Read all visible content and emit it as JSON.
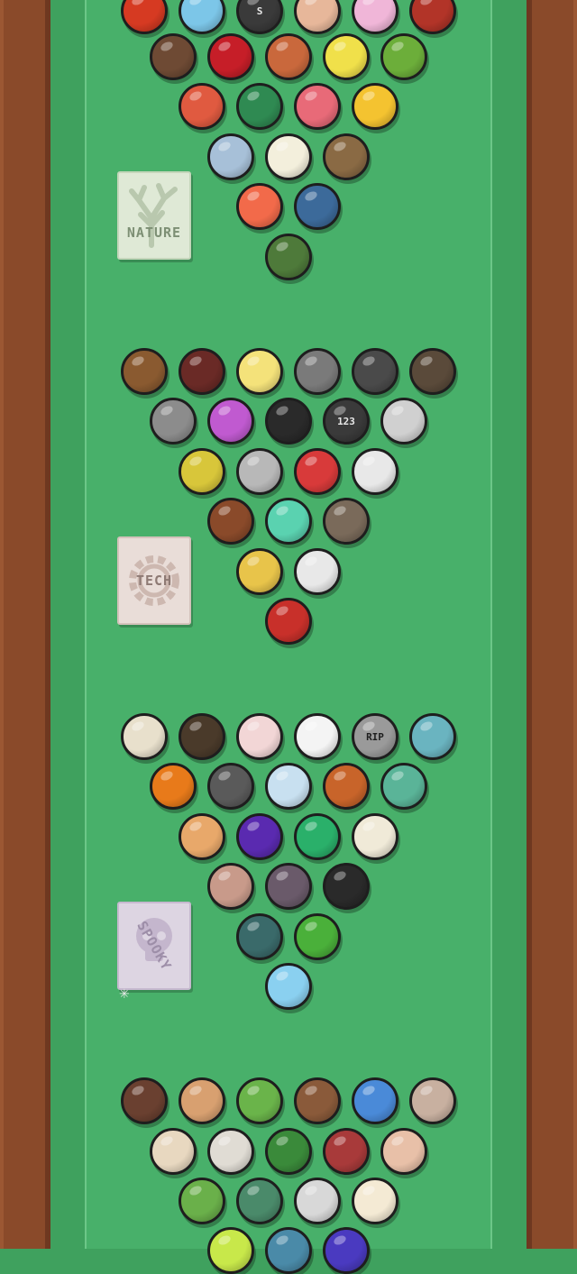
{
  "table": {
    "rail_color": "#8a4a2a",
    "felt_color": "#48b06a"
  },
  "packs": [
    {
      "id": "nature",
      "label": "NATURE",
      "icon": "tree-icon"
    },
    {
      "id": "tech",
      "label": "TECH",
      "icon": "gear-icon"
    },
    {
      "id": "spooky",
      "label": "SPOOKY",
      "icon": "skull-icon"
    }
  ],
  "ball_glyphs": {
    "s_ball": "S",
    "counter_ball": "123",
    "rip_ball": "RIP"
  },
  "balls": [
    {
      "row": 0,
      "c": "#d63a22",
      "glyph": ""
    },
    {
      "row": 0,
      "c": "#7cc6e8",
      "glyph": ""
    },
    {
      "row": 0,
      "c": "#3a3a3a",
      "glyph": "s_ball"
    },
    {
      "row": 0,
      "c": "#e7b79a",
      "glyph": ""
    },
    {
      "row": 0,
      "c": "#f0b6d8",
      "glyph": ""
    },
    {
      "row": 0,
      "c": "#b23428",
      "glyph": ""
    },
    {
      "row": 1,
      "c": "#6e4a34",
      "glyph": ""
    },
    {
      "row": 1,
      "c": "#c61e28",
      "glyph": ""
    },
    {
      "row": 1,
      "c": "#c9683c",
      "glyph": ""
    },
    {
      "row": 1,
      "c": "#f0e04a",
      "glyph": ""
    },
    {
      "row": 1,
      "c": "#6cae3a",
      "glyph": ""
    },
    {
      "row": 2,
      "c": "#e05a40",
      "glyph": ""
    },
    {
      "row": 2,
      "c": "#2f8a52",
      "glyph": ""
    },
    {
      "row": 2,
      "c": "#e86a78",
      "glyph": ""
    },
    {
      "row": 2,
      "c": "#f4c330",
      "glyph": ""
    },
    {
      "row": 3,
      "c": "#a7c0d8",
      "glyph": ""
    },
    {
      "row": 3,
      "c": "#f3efdc",
      "glyph": ""
    },
    {
      "row": 3,
      "c": "#8a6a44",
      "glyph": ""
    },
    {
      "row": 4,
      "c": "#f26a4a",
      "glyph": ""
    },
    {
      "row": 4,
      "c": "#3c6a9a",
      "glyph": ""
    },
    {
      "row": 5,
      "c": "#4e7a3a",
      "glyph": ""
    },
    {
      "row": 6,
      "c": "#8a5a30",
      "glyph": ""
    },
    {
      "row": 6,
      "c": "#6a2a26",
      "glyph": ""
    },
    {
      "row": 6,
      "c": "#f4e27a",
      "glyph": ""
    },
    {
      "row": 6,
      "c": "#7a7a7a",
      "glyph": ""
    },
    {
      "row": 6,
      "c": "#4a4a4a",
      "glyph": ""
    },
    {
      "row": 6,
      "c": "#5a4a3a",
      "glyph": ""
    },
    {
      "row": 7,
      "c": "#8c8c8c",
      "glyph": ""
    },
    {
      "row": 7,
      "c": "#c05ad0",
      "glyph": ""
    },
    {
      "row": 7,
      "c": "#2a2a2a",
      "glyph": ""
    },
    {
      "row": 7,
      "c": "#3a3a3a",
      "glyph": "counter_ball"
    },
    {
      "row": 7,
      "c": "#d0d0d0",
      "glyph": ""
    },
    {
      "row": 8,
      "c": "#d8c63a",
      "glyph": ""
    },
    {
      "row": 8,
      "c": "#b8b8b8",
      "glyph": ""
    },
    {
      "row": 8,
      "c": "#d83a3a",
      "glyph": ""
    },
    {
      "row": 8,
      "c": "#e8e8e8",
      "glyph": ""
    },
    {
      "row": 9,
      "c": "#8a4a2a",
      "glyph": ""
    },
    {
      "row": 9,
      "c": "#5ad2b0",
      "glyph": ""
    },
    {
      "row": 9,
      "c": "#7a6a5a",
      "glyph": ""
    },
    {
      "row": 10,
      "c": "#e8c44a",
      "glyph": ""
    },
    {
      "row": 10,
      "c": "#e8e8e8",
      "glyph": ""
    },
    {
      "row": 11,
      "c": "#c8302a",
      "glyph": ""
    },
    {
      "row": 12,
      "c": "#e8e0cc",
      "glyph": ""
    },
    {
      "row": 12,
      "c": "#4a3a2a",
      "glyph": ""
    },
    {
      "row": 12,
      "c": "#f2d6d6",
      "glyph": ""
    },
    {
      "row": 12,
      "c": "#f4f4f4",
      "glyph": ""
    },
    {
      "row": 12,
      "c": "#9a9a9a",
      "glyph": "rip_ball"
    },
    {
      "row": 12,
      "c": "#6ab4c0",
      "glyph": ""
    },
    {
      "row": 13,
      "c": "#e87a1a",
      "glyph": ""
    },
    {
      "row": 13,
      "c": "#5a5a5a",
      "glyph": ""
    },
    {
      "row": 13,
      "c": "#c8e0f0",
      "glyph": ""
    },
    {
      "row": 13,
      "c": "#c8642a",
      "glyph": ""
    },
    {
      "row": 13,
      "c": "#5ab498",
      "glyph": ""
    },
    {
      "row": 14,
      "c": "#e8a86a",
      "glyph": ""
    },
    {
      "row": 14,
      "c": "#5a2ab0",
      "glyph": ""
    },
    {
      "row": 14,
      "c": "#2ab06a",
      "glyph": ""
    },
    {
      "row": 14,
      "c": "#f0ead8",
      "glyph": ""
    },
    {
      "row": 15,
      "c": "#c89a8a",
      "glyph": ""
    },
    {
      "row": 15,
      "c": "#6a5a6a",
      "glyph": ""
    },
    {
      "row": 15,
      "c": "#2a2a2a",
      "glyph": ""
    },
    {
      "row": 16,
      "c": "#3a6a6a",
      "glyph": ""
    },
    {
      "row": 16,
      "c": "#4ab03a",
      "glyph": ""
    },
    {
      "row": 17,
      "c": "#8ad0f0",
      "glyph": ""
    },
    {
      "row": 18,
      "c": "#6a4030",
      "glyph": ""
    },
    {
      "row": 18,
      "c": "#d8a070",
      "glyph": ""
    },
    {
      "row": 18,
      "c": "#6ab44a",
      "glyph": ""
    },
    {
      "row": 18,
      "c": "#8a5a3a",
      "glyph": ""
    },
    {
      "row": 18,
      "c": "#4a8ad8",
      "glyph": ""
    },
    {
      "row": 18,
      "c": "#c8b0a0",
      "glyph": ""
    },
    {
      "row": 19,
      "c": "#e8d8c0",
      "glyph": ""
    },
    {
      "row": 19,
      "c": "#e0dcd4",
      "glyph": ""
    },
    {
      "row": 19,
      "c": "#3a8a3a",
      "glyph": ""
    },
    {
      "row": 19,
      "c": "#a83a3a",
      "glyph": ""
    },
    {
      "row": 19,
      "c": "#e8c0a8",
      "glyph": ""
    },
    {
      "row": 20,
      "c": "#6ab04a",
      "glyph": ""
    },
    {
      "row": 20,
      "c": "#4a8a6a",
      "glyph": ""
    },
    {
      "row": 20,
      "c": "#d8d8d8",
      "glyph": ""
    },
    {
      "row": 20,
      "c": "#f4ead4",
      "glyph": ""
    },
    {
      "row": 21,
      "c": "#c8e84a",
      "glyph": ""
    },
    {
      "row": 21,
      "c": "#4a8aa8",
      "glyph": ""
    },
    {
      "row": 21,
      "c": "#4a3ac0",
      "glyph": ""
    }
  ]
}
